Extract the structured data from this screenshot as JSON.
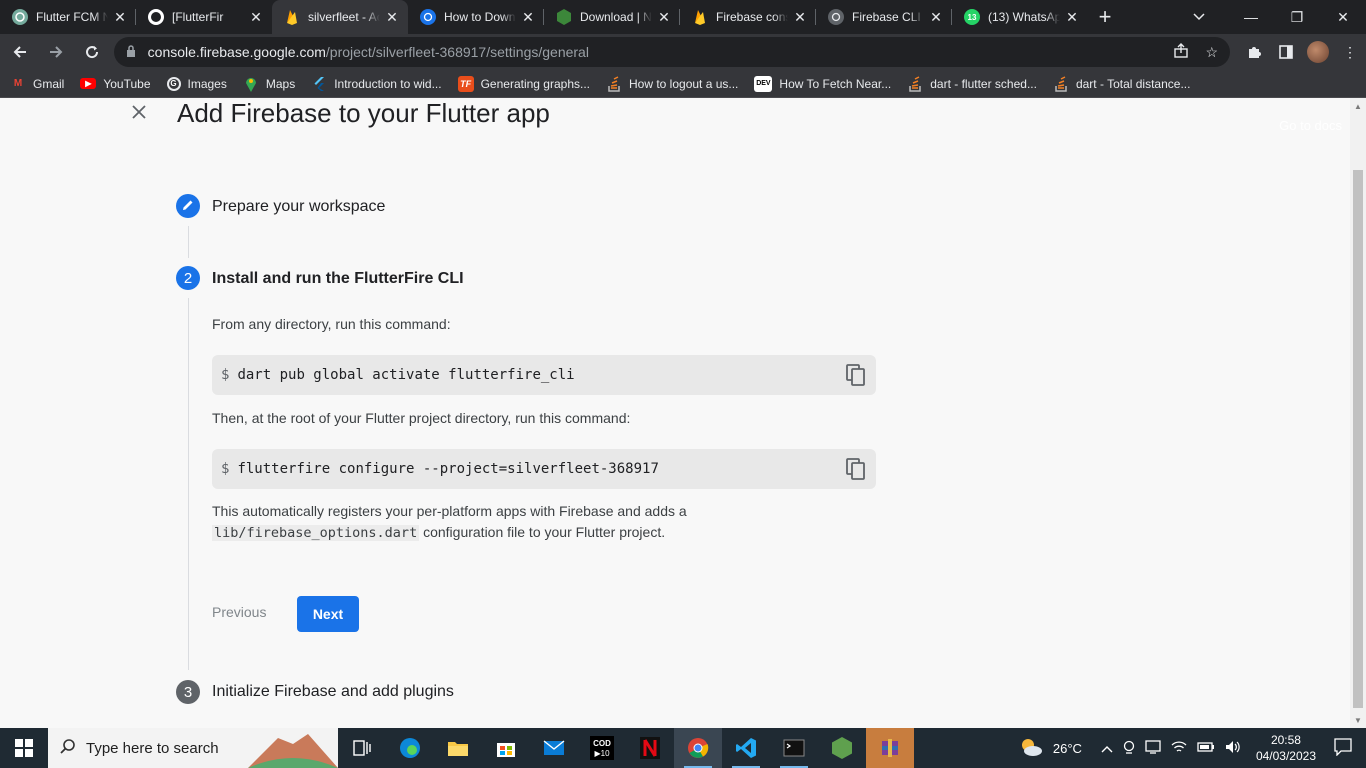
{
  "browser": {
    "tabs": [
      {
        "title": "Flutter FCM N",
        "favicon": "chatgpt-icon",
        "color": "#74aa9c"
      },
      {
        "title": "[FlutterFir",
        "favicon": "github-icon",
        "color": "#ffffff"
      },
      {
        "title": "silverfleet - Ac",
        "favicon": "firebase-icon",
        "color": "#ffca28",
        "active": true
      },
      {
        "title": "How to Down",
        "favicon": "globe-blue-icon",
        "color": "#1a73e8"
      },
      {
        "title": "Download | N",
        "favicon": "nodejs-icon",
        "color": "#3c873a"
      },
      {
        "title": "Firebase cons",
        "favicon": "firebase-icon",
        "color": "#ffca28"
      },
      {
        "title": "Firebase CLI",
        "favicon": "globe-icon",
        "color": "#9aa0a6"
      },
      {
        "title": "(13) WhatsAp",
        "favicon": "whatsapp-icon",
        "color": "#25d366",
        "badge": "13"
      }
    ],
    "new_tab_label": "+",
    "url_domain": "console.firebase.google.com",
    "url_path": "/project/silverfleet-368917/settings/general",
    "bookmarks": [
      {
        "label": "Gmail",
        "icon": "gmail-icon"
      },
      {
        "label": "YouTube",
        "icon": "youtube-icon"
      },
      {
        "label": "Images",
        "icon": "google-icon"
      },
      {
        "label": "Maps",
        "icon": "maps-icon"
      },
      {
        "label": "Introduction to wid...",
        "icon": "flutter-icon"
      },
      {
        "label": "Generating graphs...",
        "icon": "tf-icon"
      },
      {
        "label": "How to logout a us...",
        "icon": "stackoverflow-icon"
      },
      {
        "label": "How To Fetch Near...",
        "icon": "dev-icon"
      },
      {
        "label": "dart - flutter sched...",
        "icon": "stackoverflow-icon"
      },
      {
        "label": "dart - Total distance...",
        "icon": "stackoverflow-icon"
      }
    ]
  },
  "page": {
    "title": "Add Firebase to your Flutter app",
    "go_to_docs": "Go to docs",
    "steps": [
      {
        "number": "",
        "label": "Prepare your workspace",
        "state": "done"
      },
      {
        "number": "2",
        "label": "Install and run the FlutterFire CLI",
        "state": "active"
      },
      {
        "number": "3",
        "label": "Initialize Firebase and add plugins",
        "state": "pending"
      }
    ],
    "step2": {
      "intro": "From any directory, run this command:",
      "command1_prompt": "$",
      "command1": "dart pub global activate flutterfire_cli",
      "then": "Then, at the root of your Flutter project directory, run this command:",
      "command2_prompt": "$",
      "command2": "flutterfire configure --project=silverfleet-368917",
      "note_before": "This automatically registers your per-platform apps with Firebase and adds a",
      "note_code": "lib/firebase_options.dart",
      "note_after": " configuration file to your Flutter project.",
      "previous_label": "Previous",
      "next_label": "Next"
    }
  },
  "taskbar": {
    "search_placeholder": "Type here to search",
    "weather": "26°C",
    "time": "20:58",
    "date": "04/03/2023"
  },
  "colors": {
    "accent": "#1a73e8",
    "step_done": "#1a73e8",
    "step_pending": "#5f6368"
  }
}
